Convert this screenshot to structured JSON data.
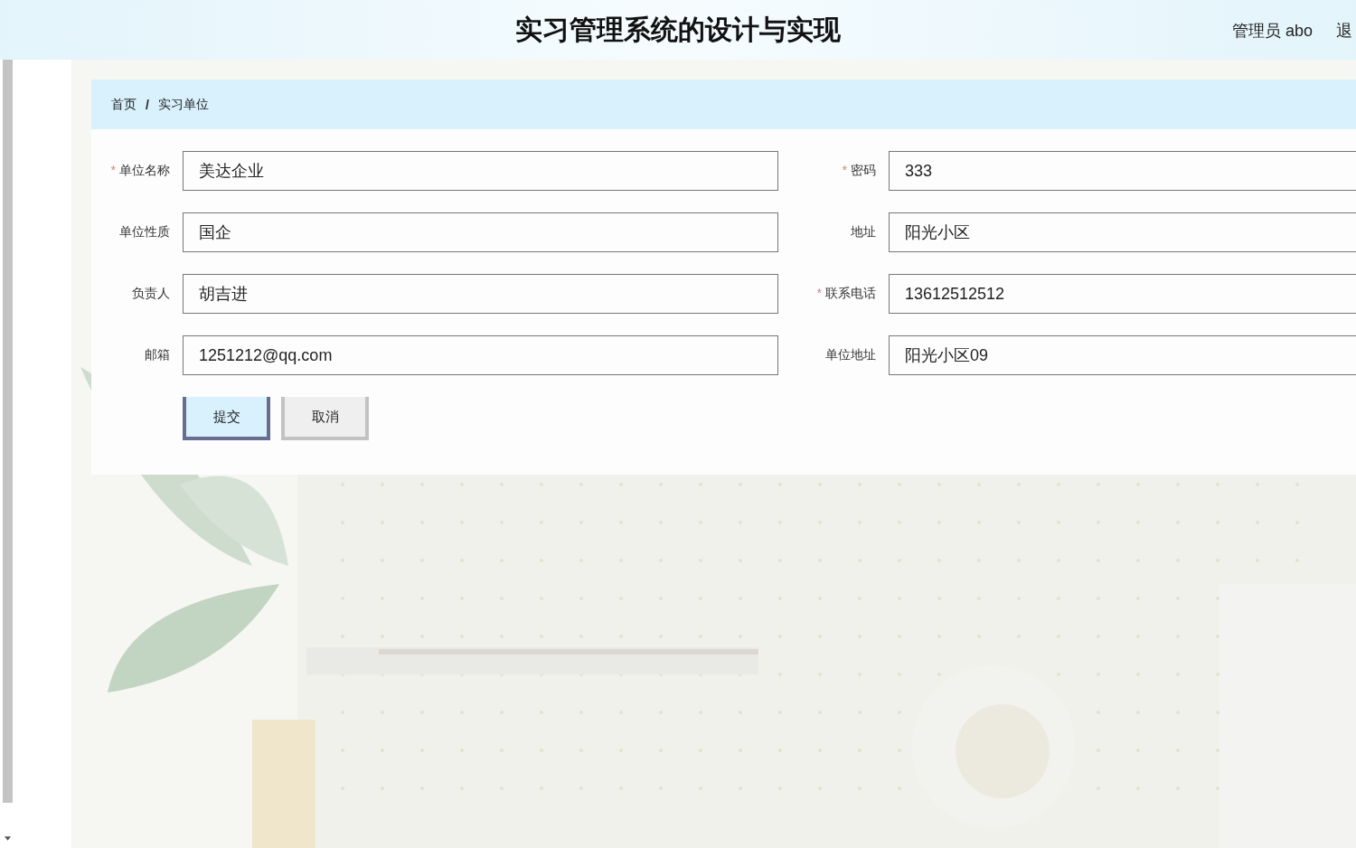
{
  "header": {
    "title": "实习管理系统的设计与实现",
    "user": "管理员 abo",
    "logout": "退"
  },
  "breadcrumb": [
    {
      "label": "首页"
    },
    {
      "label": "实习单位"
    }
  ],
  "breadcrumb_separator": "/",
  "form": {
    "fields": [
      {
        "label": "单位名称",
        "value": "美达企业",
        "required": true
      },
      {
        "label": "密码",
        "value": "333",
        "required": true
      },
      {
        "label": "单位性质",
        "value": "国企",
        "required": false
      },
      {
        "label": "地址",
        "value": "阳光小区",
        "required": false
      },
      {
        "label": "负责人",
        "value": "胡吉进",
        "required": false
      },
      {
        "label": "联系电话",
        "value": "13612512512",
        "required": true
      },
      {
        "label": "邮箱",
        "value": "1251212@qq.com",
        "required": false
      },
      {
        "label": "单位地址",
        "value": "阳光小区09",
        "required": false
      }
    ],
    "required_mark": "*",
    "buttons": [
      {
        "label": "提交",
        "kind": "primary"
      },
      {
        "label": "取消",
        "kind": "secondary"
      }
    ]
  }
}
